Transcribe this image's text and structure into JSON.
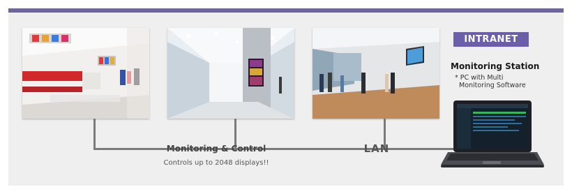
{
  "badge": {
    "label": "INTRANET",
    "color": "#6a5fa8"
  },
  "station": {
    "title": "Monitoring Station",
    "note_line1": "* PC with Multi",
    "note_line2": "Monitoring Software"
  },
  "network": {
    "monitoring_label": "Monitoring & Control",
    "monitoring_sub": "Controls up to 2048 displays!!",
    "lan_label": "LAN"
  },
  "photos": [
    {
      "name": "retail-store-photo"
    },
    {
      "name": "shopping-mall-photo"
    },
    {
      "name": "office-lobby-photo"
    }
  ],
  "colors": {
    "accent_bar": "#6c6699",
    "background": "#efefef",
    "line": "#7a7a7a"
  }
}
